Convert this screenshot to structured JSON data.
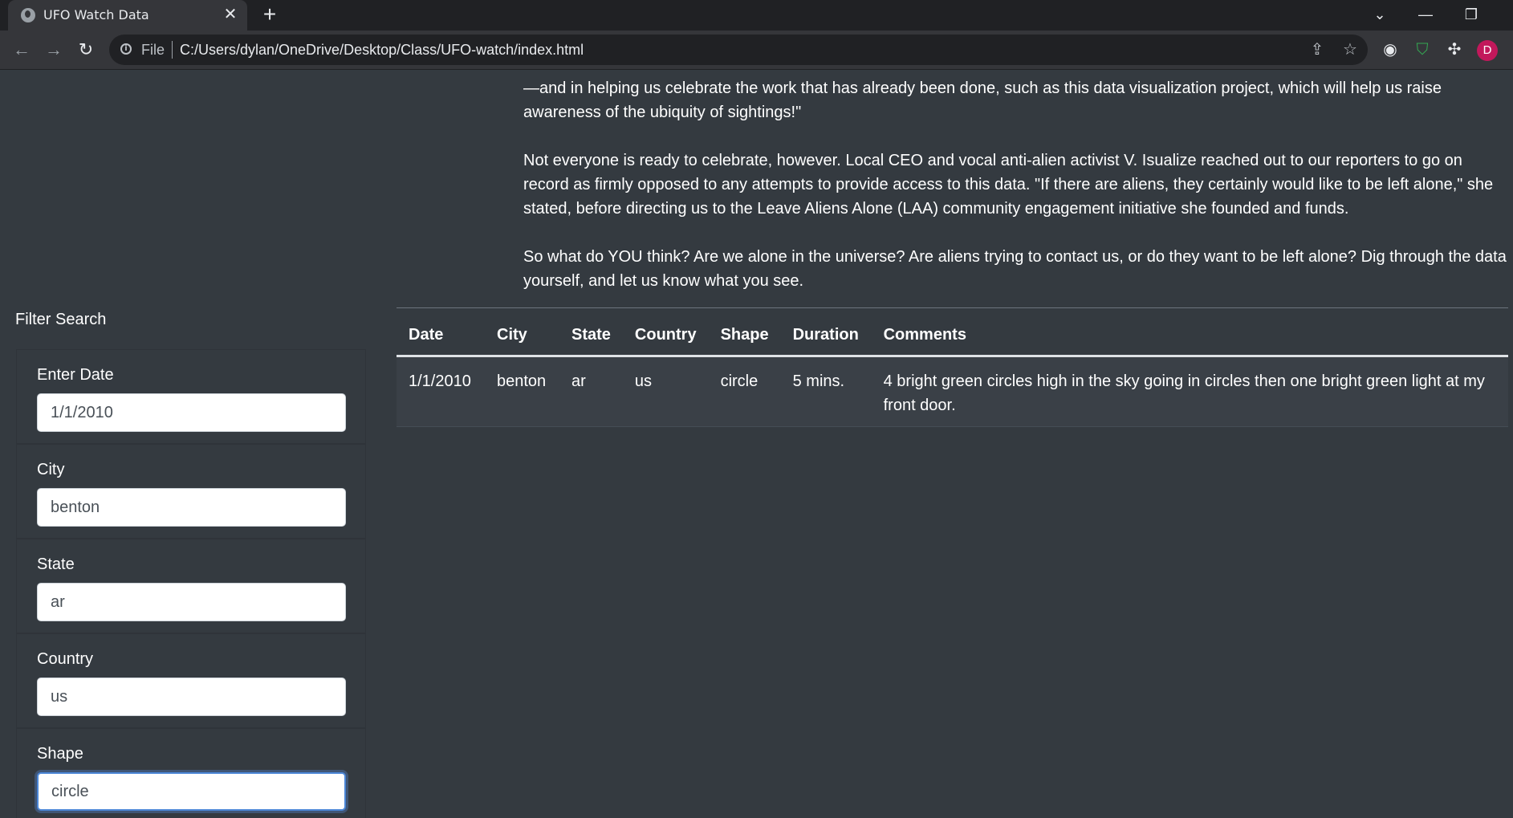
{
  "browser": {
    "tab_title": "UFO Watch Data",
    "close_glyph": "✕",
    "new_tab_glyph": "+",
    "file_label": "File",
    "url": "C:/Users/dylan/OneDrive/Desktop/Class/UFO-watch/index.html",
    "avatar_letter": "D",
    "accent_avatar": "#c2185b"
  },
  "article": {
    "paragraph1": "—and in helping us celebrate the work that has already been done, such as this data visualization project, which will help us raise awareness of the ubiquity of sightings!\"",
    "paragraph2": "Not everyone is ready to celebrate, however. Local CEO and vocal anti-alien activist V. Isualize reached out to our reporters to go on record as firmly opposed to any attempts to provide access to this data. \"If there are aliens, they certainly would like to be left alone,\" she stated, before directing us to the Leave Aliens Alone (LAA) community engagement initiative she founded and funds.",
    "paragraph3": "So what do YOU think? Are we alone in the universe? Are aliens trying to contact us, or do they want to be left alone? Dig through the data yourself, and let us know what you see."
  },
  "filters": {
    "title": "Filter Search",
    "items": [
      {
        "label": "Enter Date",
        "value": "1/1/2010"
      },
      {
        "label": "City",
        "value": "benton"
      },
      {
        "label": "State",
        "value": "ar"
      },
      {
        "label": "Country",
        "value": "us"
      },
      {
        "label": "Shape",
        "value": "circle"
      }
    ]
  },
  "table": {
    "headers": [
      "Date",
      "City",
      "State",
      "Country",
      "Shape",
      "Duration",
      "Comments"
    ],
    "rows": [
      [
        "1/1/2010",
        "benton",
        "ar",
        "us",
        "circle",
        "5 mins.",
        "4 bright green circles high in the sky going in circles then one bright green light at my front door."
      ]
    ]
  }
}
